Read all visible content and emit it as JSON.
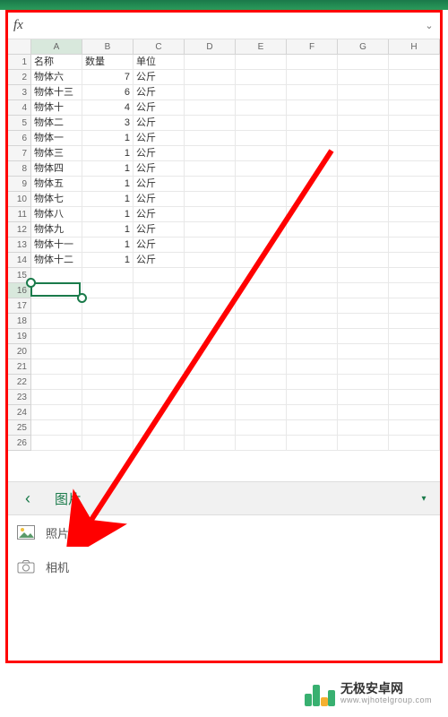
{
  "formula_bar": {
    "fx": "fx",
    "expand_icon": "⌄"
  },
  "columns": [
    "A",
    "B",
    "C",
    "D",
    "E",
    "F",
    "G",
    "H"
  ],
  "row_count": 26,
  "selected_col_index": 0,
  "selected_row_index": 15,
  "headers": {
    "c1": "名称",
    "c2": "数量",
    "c3": "单位"
  },
  "rows": [
    {
      "name": "物体六",
      "qty": 7,
      "unit": "公斤"
    },
    {
      "name": "物体十三",
      "qty": 6,
      "unit": "公斤"
    },
    {
      "name": "物体十",
      "qty": 4,
      "unit": "公斤"
    },
    {
      "name": "物体二",
      "qty": 3,
      "unit": "公斤"
    },
    {
      "name": "物体一",
      "qty": 1,
      "unit": "公斤"
    },
    {
      "name": "物体三",
      "qty": 1,
      "unit": "公斤"
    },
    {
      "name": "物体四",
      "qty": 1,
      "unit": "公斤"
    },
    {
      "name": "物体五",
      "qty": 1,
      "unit": "公斤"
    },
    {
      "name": "物体七",
      "qty": 1,
      "unit": "公斤"
    },
    {
      "name": "物体八",
      "qty": 1,
      "unit": "公斤"
    },
    {
      "name": "物体九",
      "qty": 1,
      "unit": "公斤"
    },
    {
      "name": "物体十一",
      "qty": 1,
      "unit": "公斤"
    },
    {
      "name": "物体十二",
      "qty": 1,
      "unit": "公斤"
    }
  ],
  "panel": {
    "back_icon": "‹",
    "title": "图片",
    "dropdown_icon": "▾"
  },
  "options": {
    "photos": "照片",
    "camera": "相机"
  },
  "watermark": {
    "main": "无极安卓网",
    "sub": "www.wjhotelgroup.com"
  }
}
